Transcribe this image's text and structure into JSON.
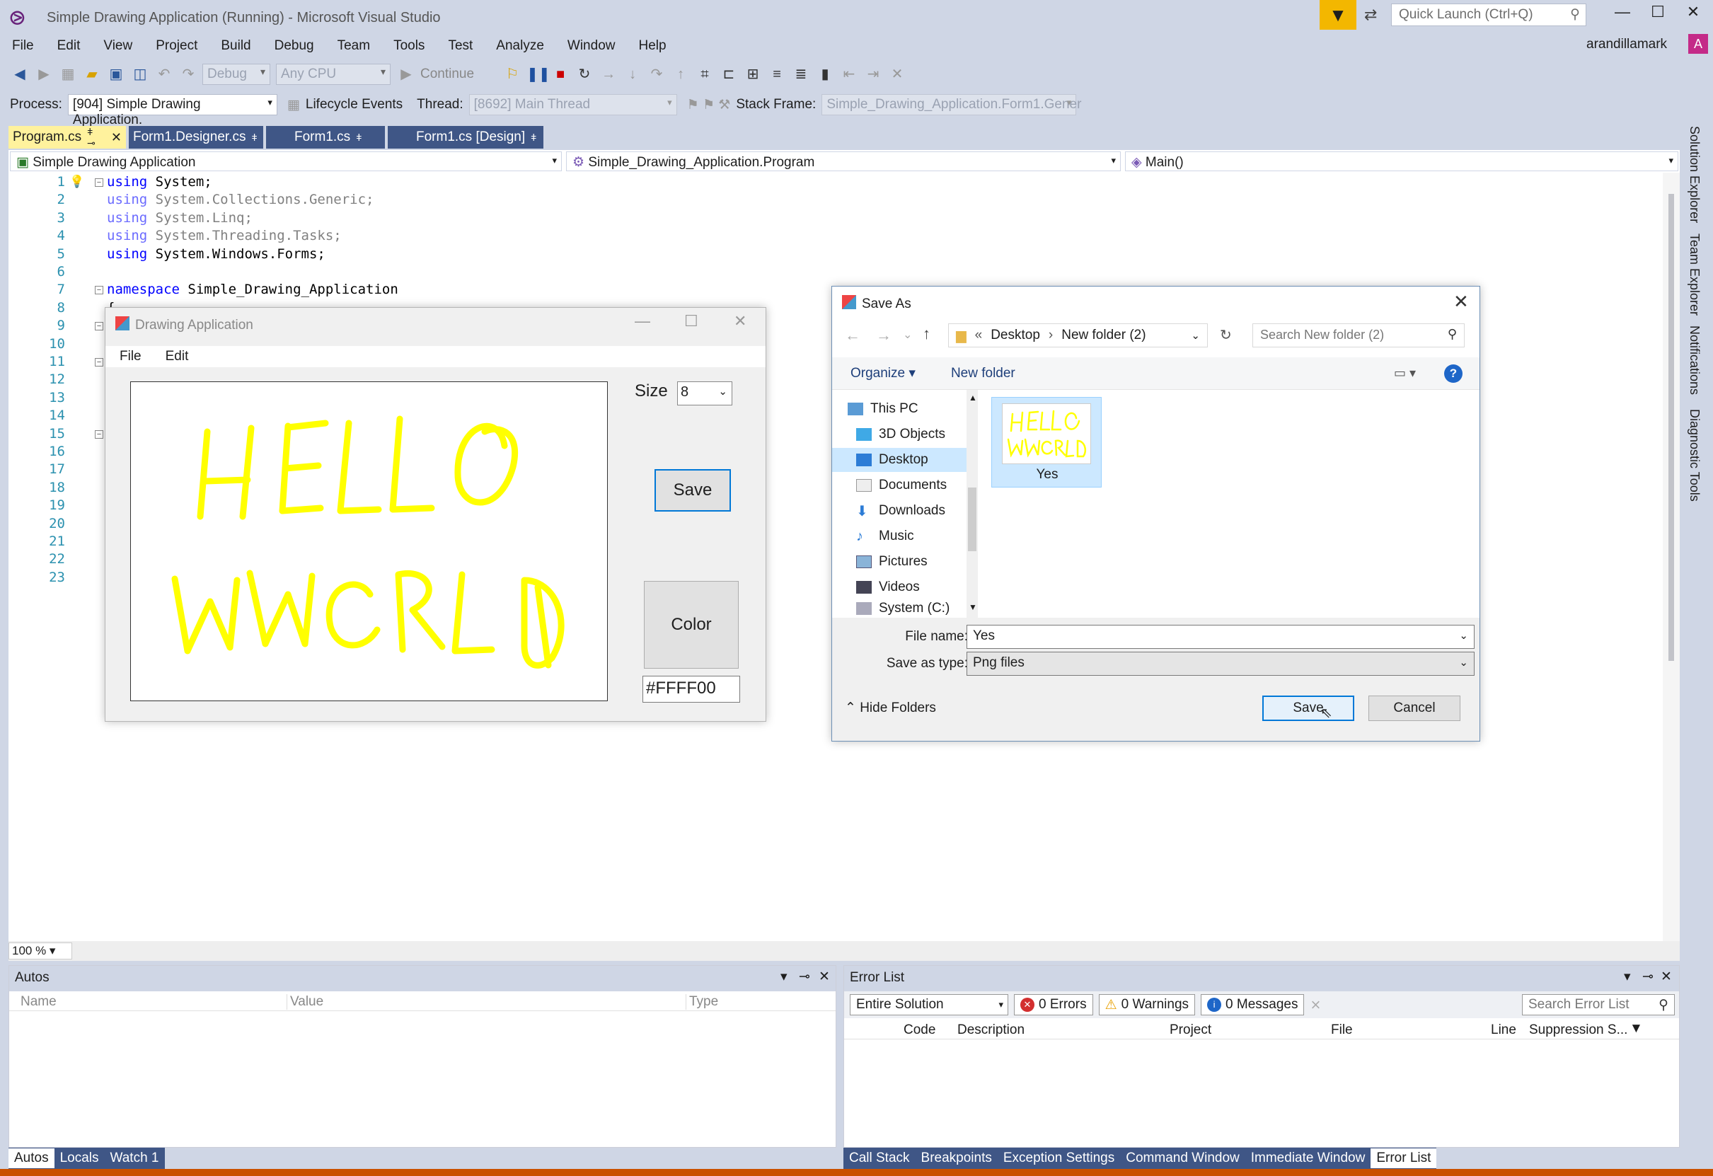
{
  "window": {
    "title": "Simple Drawing Application (Running) - Microsoft Visual Studio",
    "quick_launch_placeholder": "Quick Launch (Ctrl+Q)",
    "user": "arandillamark",
    "avatar_letter": "A"
  },
  "menu": [
    "File",
    "Edit",
    "View",
    "Project",
    "Build",
    "Debug",
    "Team",
    "Tools",
    "Test",
    "Analyze",
    "Window",
    "Help"
  ],
  "toolbar": {
    "config": "Debug",
    "platform": "Any CPU",
    "continue_label": "Continue"
  },
  "debugbar": {
    "process_label": "Process:",
    "process_value": "[904] Simple Drawing Application.",
    "lifecycle_label": "Lifecycle Events",
    "thread_label": "Thread:",
    "thread_value": "[8692] Main Thread",
    "stackframe_label": "Stack Frame:",
    "stackframe_value": "Simple_Drawing_Application.Form1.Gener"
  },
  "tabs": [
    {
      "label": "Program.cs",
      "active": true
    },
    {
      "label": "Form1.Designer.cs",
      "active": false
    },
    {
      "label": "Form1.cs",
      "active": false
    },
    {
      "label": "Form1.cs [Design]",
      "active": false
    }
  ],
  "navbar": {
    "project": "Simple Drawing Application",
    "class": "Simple_Drawing_Application.Program",
    "member": "Main()"
  },
  "editor": {
    "line_numbers": [
      "1",
      "2",
      "3",
      "4",
      "5",
      "6",
      "7",
      "8",
      "9",
      "10",
      "11",
      "12",
      "13",
      "14",
      "15",
      "16",
      "17",
      "18",
      "19",
      "20",
      "21",
      "22",
      "23"
    ],
    "lines": [
      {
        "kw": "using",
        "rest": " System;",
        "dim": false
      },
      {
        "kw": "using",
        "rest": " System.Collections.Generic;",
        "dim": true
      },
      {
        "kw": "using",
        "rest": " System.Linq;",
        "dim": true
      },
      {
        "kw": "using",
        "rest": " System.Threading.Tasks;",
        "dim": true
      },
      {
        "kw": "using",
        "rest": " System.Windows.Forms;",
        "dim": false
      },
      {
        "kw": "",
        "rest": "",
        "dim": false
      },
      {
        "kw": "namespace",
        "rest": " Simple_Drawing_Application",
        "dim": false
      },
      {
        "kw": "",
        "rest": "{",
        "dim": false
      }
    ],
    "zoom": "100 %"
  },
  "side_tabs": [
    "Solution Explorer",
    "Team Explorer",
    "Notifications",
    "Diagnostic Tools"
  ],
  "drawing_form": {
    "title": "Drawing Application",
    "menu": [
      "File",
      "Edit"
    ],
    "size_label": "Size",
    "size_value": "8",
    "save_label": "Save",
    "color_label": "Color",
    "color_hex": "#FFFF00",
    "ink_color": "#ffff00"
  },
  "save_dialog": {
    "title": "Save As",
    "breadcrumb": [
      "«",
      "Desktop",
      "›",
      "New folder (2)"
    ],
    "search_placeholder": "Search New folder (2)",
    "organize_label": "Organize",
    "new_folder_label": "New folder",
    "nav_items": [
      "This PC",
      "3D Objects",
      "Desktop",
      "Documents",
      "Downloads",
      "Music",
      "Pictures",
      "Videos",
      "System (C:)"
    ],
    "selected_nav": "Desktop",
    "file_item": "Yes",
    "file_name_label": "File name:",
    "file_name_value": "Yes",
    "save_type_label": "Save as type:",
    "save_type_value": "Png files",
    "hide_folders_label": "Hide Folders",
    "save_label": "Save",
    "cancel_label": "Cancel"
  },
  "autos_panel": {
    "title": "Autos",
    "columns": [
      "Name",
      "Value",
      "Type"
    ],
    "tabs": [
      "Autos",
      "Locals",
      "Watch 1"
    ]
  },
  "error_panel": {
    "title": "Error List",
    "scope": "Entire Solution",
    "errors": "0 Errors",
    "warnings": "0 Warnings",
    "messages": "0 Messages",
    "search_placeholder": "Search Error List",
    "columns": [
      "Code",
      "Description",
      "Project",
      "File",
      "Line",
      "Suppression S..."
    ],
    "tabs": [
      "Call Stack",
      "Breakpoints",
      "Exception Settings",
      "Command Window",
      "Immediate Window",
      "Error List"
    ]
  },
  "colors": {
    "chrome": "#cfd6e5",
    "accent_filter": "#f3b700",
    "status_bar": "#ca5100",
    "keyword": "#0000ff",
    "line_number": "#2b91af"
  }
}
